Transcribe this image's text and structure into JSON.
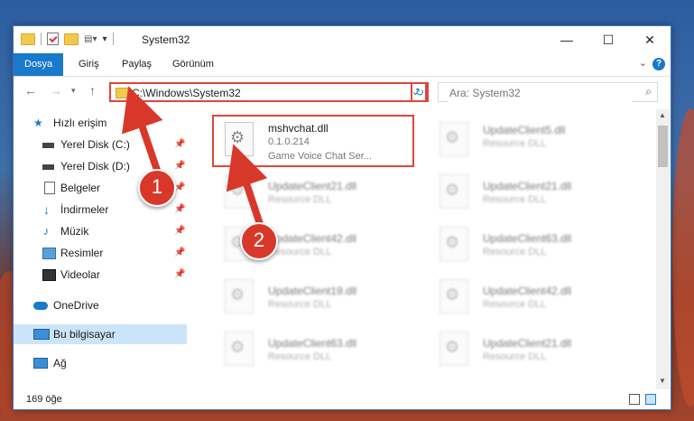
{
  "window": {
    "title": "System32",
    "controls": {
      "minimize": "—",
      "maximize": "☐",
      "close": "✕"
    }
  },
  "ribbon": {
    "tabs": [
      "Dosya",
      "Giriş",
      "Paylaş",
      "Görünüm"
    ],
    "active_tab": "Dosya",
    "help": "?"
  },
  "address": {
    "path": "C:\\Windows\\System32",
    "search_placeholder": "Ara: System32"
  },
  "nav": {
    "quick_access": "Hızlı erişim",
    "items": [
      {
        "label": "Yerel Disk (C:)",
        "icon": "drive-icon",
        "pinned": true
      },
      {
        "label": "Yerel Disk (D:)",
        "icon": "drive-icon",
        "pinned": true
      },
      {
        "label": "Belgeler",
        "icon": "documents-icon",
        "pinned": true
      },
      {
        "label": "İndirmeler",
        "icon": "download-icon",
        "pinned": true
      },
      {
        "label": "Müzik",
        "icon": "music-icon",
        "pinned": true
      },
      {
        "label": "Resimler",
        "icon": "pictures-icon",
        "pinned": true
      },
      {
        "label": "Videolar",
        "icon": "videos-icon",
        "pinned": true
      }
    ],
    "onedrive": "OneDrive",
    "this_pc": "Bu bilgisayar",
    "network": "Ağ"
  },
  "files": {
    "main": {
      "name": "mshvchat.dll",
      "version": "0.1.0.214",
      "description": "Game Voice Chat Ser..."
    },
    "left_column": [
      {
        "name": "UpdateClient21.dll",
        "type": "Resource DLL"
      },
      {
        "name": "UpdateClient42.dll",
        "type": "Resource DLL"
      },
      {
        "name": "UpdateClient19.dll",
        "type": "Resource DLL"
      },
      {
        "name": "UpdateClient63.dll",
        "type": "Resource DLL"
      }
    ],
    "right_column": [
      {
        "name": "UpdateClient5.dll",
        "type": "Resource DLL"
      },
      {
        "name": "UpdateClient21.dll",
        "type": "Resource DLL"
      },
      {
        "name": "UpdateClient63.dll",
        "type": "Resource DLL"
      },
      {
        "name": "UpdateClient42.dll",
        "type": "Resource DLL"
      },
      {
        "name": "UpdateClient21.dll",
        "type": "Resource DLL"
      }
    ]
  },
  "status": {
    "item_count": "169 öğe"
  },
  "callouts": [
    "1",
    "2"
  ],
  "colors": {
    "accent": "#1979ca",
    "highlight": "#e0453a",
    "selection": "#cce4f7"
  }
}
